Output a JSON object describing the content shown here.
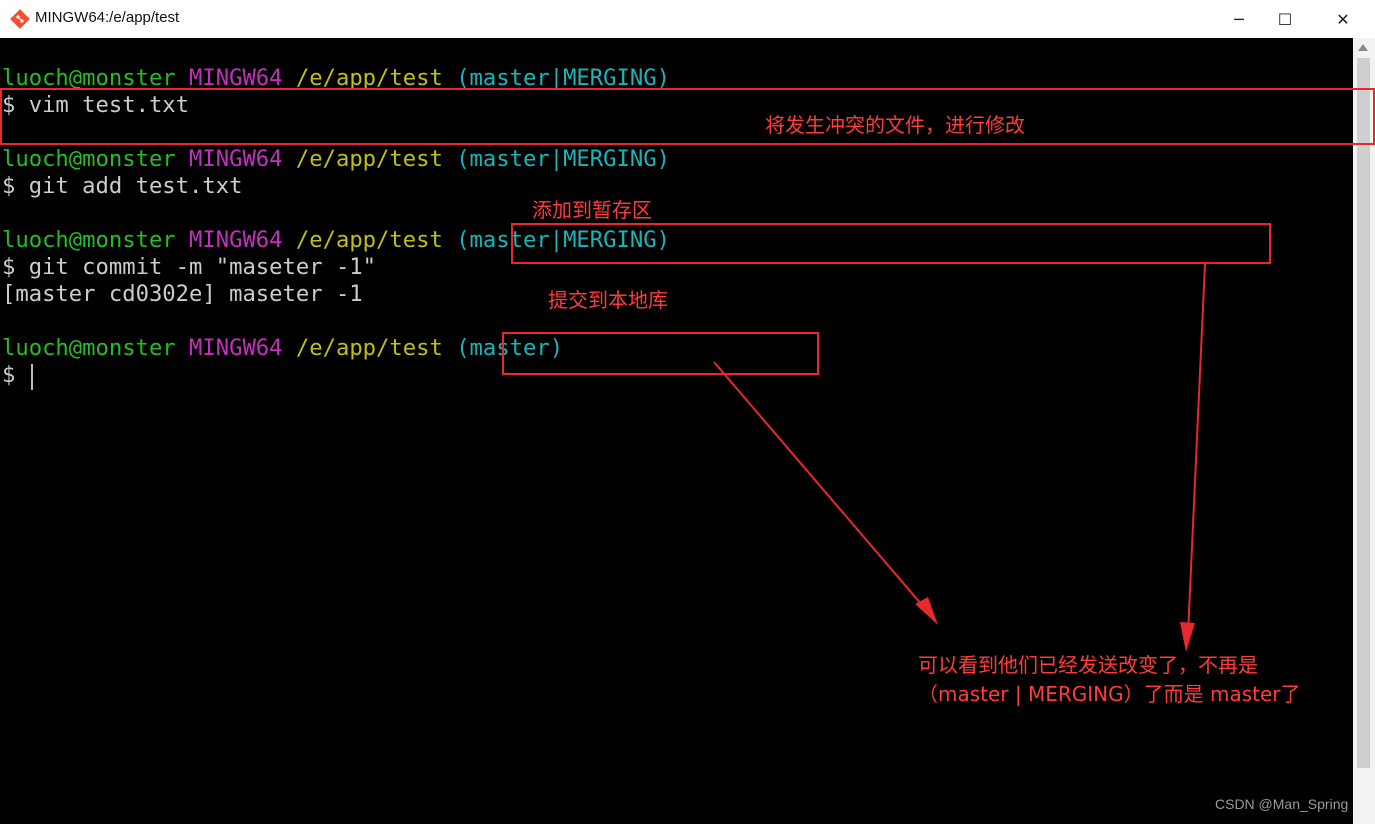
{
  "window": {
    "title": "MINGW64:/e/app/test",
    "app_icon": "git-logo-icon",
    "controls": {
      "minimize": "─",
      "maximize": "☐",
      "close": "✕"
    }
  },
  "terminal": {
    "prompt_user": "luoch@monster",
    "prompt_host": "MINGW64",
    "prompt_path": "/e/app/test",
    "lines": [
      {
        "branch": "(master|MERGING)",
        "command": "$ vim test.txt"
      },
      {
        "branch": "(master|MERGING)",
        "command": "$ git add test.txt"
      },
      {
        "branch": "(master|MERGING)",
        "command": "$ git commit -m \"maseter -1\"",
        "output": "[master cd0302e] maseter -1"
      },
      {
        "branch": "(master)",
        "command": "$ "
      }
    ]
  },
  "annotations": {
    "edit_file": "将发生冲突的文件，进行修改",
    "add_staging": "添加到暂存区",
    "commit_local": "提交到本地库",
    "conclusion_line1": "可以看到他们已经发送改变了，不再是",
    "conclusion_line2": "（master | MERGING）了而是 master了"
  },
  "colors": {
    "user": "#25bc24",
    "host": "#c42fbe",
    "path": "#bfbf18",
    "branch": "#19b5b8",
    "annotation": "#ff3b3b"
  },
  "watermark": "CSDN @Man_Spring"
}
